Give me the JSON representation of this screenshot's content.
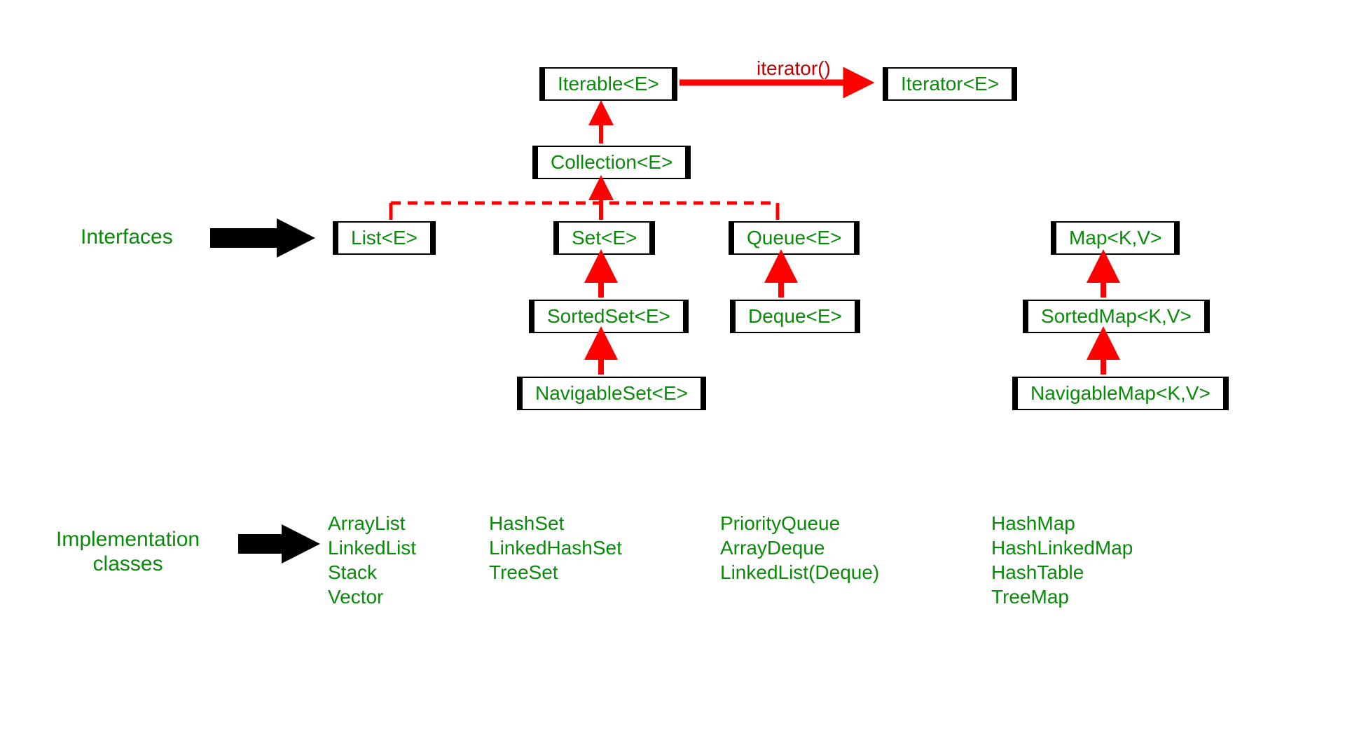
{
  "labels": {
    "interfaces": "Interfaces",
    "impl_line1": "Implementation",
    "impl_line2": "classes",
    "iterator_method": "iterator()"
  },
  "boxes": {
    "iterable": "Iterable<E>",
    "iterator": "Iterator<E>",
    "collection": "Collection<E>",
    "list": "List<E>",
    "set": "Set<E>",
    "queue": "Queue<E>",
    "sortedset": "SortedSet<E>",
    "deque": "Deque<E>",
    "navigableset": "NavigableSet<E>",
    "map": "Map<K,V>",
    "sortedmap": "SortedMap<K,V>",
    "navigablemap": "NavigableMap<K,V>"
  },
  "impl": {
    "list": [
      "ArrayList",
      "LinkedList",
      "Stack",
      "Vector"
    ],
    "set": [
      "HashSet",
      "LinkedHashSet",
      "TreeSet"
    ],
    "queue": [
      "PriorityQueue",
      "ArrayDeque",
      "LinkedList(Deque)"
    ],
    "map": [
      "HashMap",
      "HashLinkedMap",
      "HashTable",
      "TreeMap"
    ]
  },
  "colors": {
    "text_green": "#0a8a0a",
    "arrow_red": "#ff0000",
    "arrow_black": "#000000",
    "box_border": "#000000"
  }
}
